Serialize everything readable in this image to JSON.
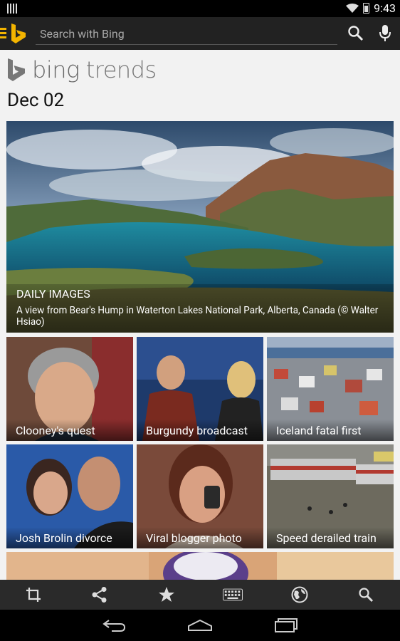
{
  "status": {
    "time": "9:43"
  },
  "search": {
    "placeholder": "Search with Bing"
  },
  "brand": {
    "name_main": "bing",
    "name_sub": "trends"
  },
  "date": "Dec 02",
  "hero": {
    "category": "DAILY IMAGES",
    "description": "A view from Bear's Hump in Waterton Lakes National Park, Alberta, Canada (© Walter Hsiao)"
  },
  "tiles": [
    {
      "label": "Clooney's quest"
    },
    {
      "label": "Burgundy broadcast"
    },
    {
      "label": "Iceland fatal first"
    },
    {
      "label": "Josh Brolin divorce"
    },
    {
      "label": "Viral blogger photo"
    },
    {
      "label": "Speed derailed train"
    }
  ],
  "colors": {
    "accent": "#f3b400",
    "topbar": "#222222",
    "bottombar": "#2a2a2a"
  },
  "icons": {
    "topbar": [
      "menu-icon",
      "bing-logo-icon",
      "search-icon",
      "microphone-icon"
    ],
    "bottombar": [
      "crop-icon",
      "share-icon",
      "star-icon",
      "keyboard-icon",
      "globe-icon",
      "search-icon"
    ],
    "navbar": [
      "back-icon",
      "home-icon",
      "recent-apps-icon"
    ]
  }
}
